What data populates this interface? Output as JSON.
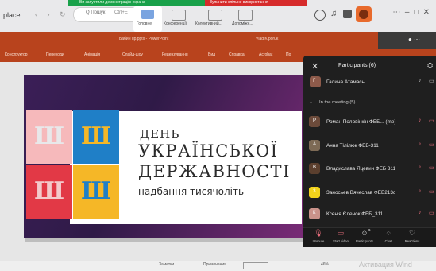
{
  "browser": {
    "tab_label": "place",
    "nav_arrows": "‹ › ↻",
    "search_label": "Q Пошук",
    "search_hint": "Ctrl+E",
    "share_banner": "Ви запустили демонстрацію екрана",
    "stop_banner": "Зупинити спільне використання",
    "ribbon_items": [
      {
        "label": "Головне"
      },
      {
        "label": "Конференції"
      },
      {
        "label": "Колективний..."
      },
      {
        "label": "Допоміжн..."
      }
    ],
    "icons": [
      "help-icon",
      "bell-icon",
      "apps-icon",
      "more-icon",
      "minimize-icon",
      "maximize-icon",
      "close-icon"
    ]
  },
  "ppt": {
    "title": "Бабин яр.pptx  -  PowerPoint",
    "user": "Vlad Kiporuk",
    "ribbon_tabs": [
      "Конструктор",
      "Переходи",
      "Анімація",
      "Слайд-шоу",
      "Рецензування",
      "Вид",
      "Справка",
      "Acrobat",
      "По"
    ]
  },
  "slide": {
    "line1": "ДЕНЬ",
    "line2": "УКРАЇНСЬКОЇ",
    "line3": "ДЕРЖАВНОСТІ",
    "line4": "надбання тисячоліть",
    "trident": "Ш",
    "colors": {
      "pink": "#f6b9bb",
      "blue": "#1f7fc7",
      "red": "#e23946",
      "yellow": "#f5b727"
    }
  },
  "status": {
    "notes": "Заметки",
    "comments": "Примечания",
    "zoom": "46%",
    "watermark": "Активация Wind"
  },
  "teams": {
    "title": "Participants (6)",
    "host": {
      "name": "Галина Атамась",
      "initial": "Г",
      "color": "#8d5a4a"
    },
    "section_label": "In the meeting (5)",
    "participants": [
      {
        "name": "Роман Половінкін ФЕБ... (me)",
        "initial": "Р",
        "color": "#6b4a3a"
      },
      {
        "name": "Анна Тілілюк ФЕБ-311",
        "initial": "А",
        "color": "#7d6a55"
      },
      {
        "name": "Владислава Яцевич ФЕБ 311",
        "initial": "В",
        "color": "#5b3f2e"
      },
      {
        "name": "Заносьев Вячеслав ФЕБ213с",
        "initial": "З",
        "color": "#f1d21b"
      },
      {
        "name": "Ксенія Єленок ФЕБ_311",
        "initial": "К",
        "color": "#c9928a"
      }
    ],
    "controls": [
      {
        "label": "Unmute",
        "icon": "mic-off-icon",
        "glyph": "🎙",
        "color": "#e46c7a"
      },
      {
        "label": "Start video",
        "icon": "video-off-icon",
        "glyph": "▭",
        "color": "#e46c7a"
      },
      {
        "label": "Participants",
        "icon": "participants-icon",
        "glyph": "☺",
        "color": "#e0e0e0"
      },
      {
        "label": "Chat",
        "icon": "chat-icon",
        "glyph": "◌",
        "color": "#e0e0e0"
      },
      {
        "label": "Reactions",
        "icon": "reactions-icon",
        "glyph": "♡",
        "color": "#e0e0e0"
      }
    ],
    "participants_badge": "6"
  }
}
